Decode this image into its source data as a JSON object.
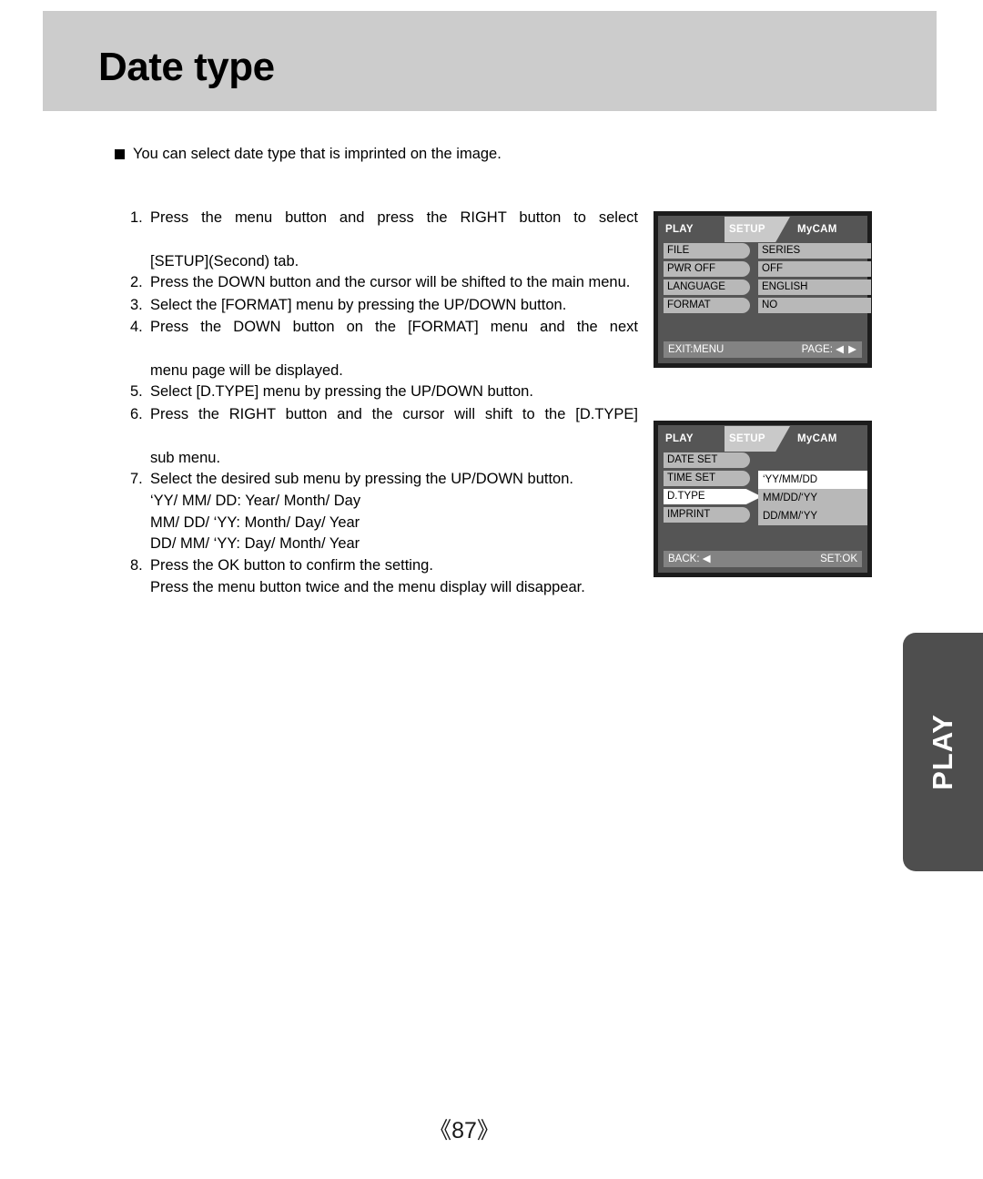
{
  "document": {
    "title": "Date type",
    "page_number": "《87》",
    "side_tab_label": "PLAY"
  },
  "intro": {
    "bullet": "square-bullet",
    "text": "You can select date type that is imprinted on the image."
  },
  "steps": [
    {
      "num": "1.",
      "text": "Press the menu button and press the RIGHT button to select",
      "cont": "[SETUP](Second) tab.",
      "justify": true
    },
    {
      "num": "2.",
      "text": "Press the DOWN button and the cursor will be shifted to the main menu.",
      "justify": false
    },
    {
      "num": "3.",
      "text": "Select the [FORMAT] menu by pressing the UP/DOWN button.",
      "justify": false
    },
    {
      "num": "4.",
      "text": "Press the DOWN button on the [FORMAT] menu and the next",
      "cont": "menu page will be displayed.",
      "justify": true
    },
    {
      "num": "5.",
      "text": "Select [D.TYPE] menu by pressing the UP/DOWN button.",
      "justify": false
    },
    {
      "num": "6.",
      "text": "Press the RIGHT button and the cursor will shift to the [D.TYPE]",
      "cont": "sub menu.",
      "justify": true
    },
    {
      "num": "7.",
      "text": "Select the desired sub menu by pressing the UP/DOWN button.",
      "justify": false
    },
    {
      "num": "8.",
      "text": "Press the OK button to confirm the setting.",
      "cont": "Press the menu button twice and the menu display will disappear.",
      "justify": false
    }
  ],
  "date_formats": [
    "‘YY/ MM/ DD: Year/ Month/ Day",
    "MM/ DD/ ‘YY: Month/ Day/ Year",
    "DD/ MM/ ‘YY: Day/ Month/ Year"
  ],
  "lcd_screen_1": {
    "tabs": {
      "left": "PLAY",
      "center": "SETUP",
      "right": "MyCAM"
    },
    "rows": [
      {
        "label": "FILE",
        "value": "SERIES"
      },
      {
        "label": "PWR OFF",
        "value": "OFF"
      },
      {
        "label": "LANGUAGE",
        "value": "ENGLISH"
      },
      {
        "label": "FORMAT",
        "value": "NO"
      }
    ],
    "bottom": {
      "left": "EXIT:MENU",
      "right": "PAGE:",
      "arrows": "◀ ▶"
    }
  },
  "lcd_screen_2": {
    "tabs": {
      "left": "PLAY",
      "center": "SETUP",
      "right": "MyCAM"
    },
    "rows": [
      {
        "label": "DATE SET",
        "selected": false
      },
      {
        "label": "TIME SET",
        "selected": false
      },
      {
        "label": "D.TYPE",
        "selected": true
      },
      {
        "label": "IMPRINT",
        "selected": false
      }
    ],
    "submenu": [
      {
        "label": "‘YY/MM/DD",
        "highlight": true
      },
      {
        "label": "MM/DD/‘YY",
        "highlight": false
      },
      {
        "label": "DD/MM/‘YY",
        "highlight": false
      }
    ],
    "bottom": {
      "left": "BACK:",
      "left_arrow": "◀",
      "right": "SET:OK"
    }
  },
  "colors": {
    "header_band": "#cccccc",
    "lcd_bezel": "#1c1c1c",
    "lcd_background": "#555555",
    "lcd_item": "#b8b8b8",
    "lcd_highlight": "#ffffff",
    "lcd_bottom_bar": "#838383",
    "side_tab": "#4e4e4e"
  }
}
